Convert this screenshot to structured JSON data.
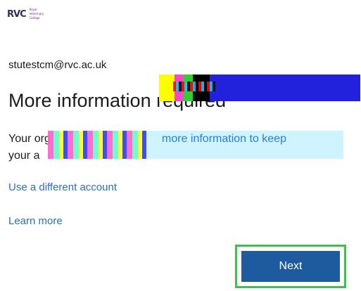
{
  "logo": {
    "mark": "RVC",
    "words": [
      "Royal",
      "Veterinary",
      "College"
    ]
  },
  "account": {
    "email": "stutestcm@rvc.ac.uk"
  },
  "header": {
    "title": "More information required"
  },
  "message": {
    "lead": "Your org",
    "visible_tail": "more information to keep",
    "line2_start": "your a"
  },
  "links": {
    "different_account": "Use a different account",
    "learn_more": "Learn more"
  },
  "actions": {
    "next_label": "Next"
  },
  "colors": {
    "accent_button": "#1d5a9e",
    "focus_ring": "#39c449",
    "link": "#2a6fb8"
  }
}
